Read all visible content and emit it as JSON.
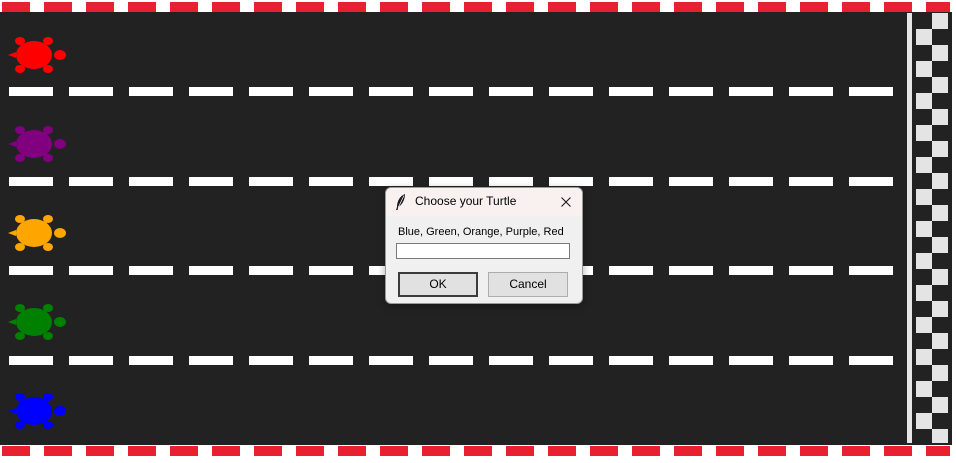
{
  "dialog": {
    "title": "Choose your Turtle",
    "prompt": "Blue, Green, Orange, Purple, Red",
    "input_value": "",
    "ok_label": "OK",
    "cancel_label": "Cancel"
  },
  "turtles": [
    {
      "color_name": "red",
      "color": "#ff0000"
    },
    {
      "color_name": "purple",
      "color": "#800080"
    },
    {
      "color_name": "orange",
      "color": "#ffa500"
    },
    {
      "color_name": "green",
      "color": "#008000"
    },
    {
      "color_name": "blue",
      "color": "#0000ff"
    }
  ],
  "track": {
    "surface_color": "#222222",
    "curb_colors": [
      "#e8202f",
      "#ffffff"
    ],
    "finish_line": "checkered"
  },
  "icons": {
    "title_icon": "feather-icon",
    "close_icon": "close-icon"
  }
}
